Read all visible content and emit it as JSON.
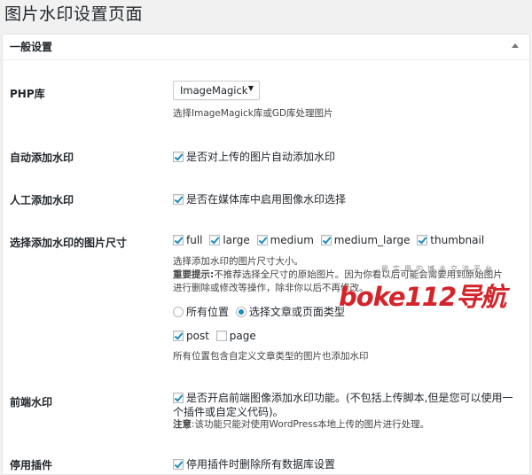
{
  "page": {
    "title": "图片水印设置页面"
  },
  "section": {
    "title": "一般设置"
  },
  "rows": {
    "php_lib": {
      "label": "PHP库",
      "select_value": "ImageMagick",
      "desc": "选择ImageMagick库或GD库处理图片"
    },
    "auto_watermark": {
      "label": "自动添加水印",
      "checkbox_label": "是否对上传的图片自动添加水印"
    },
    "manual_watermark": {
      "label": "人工添加水印",
      "checkbox_label": "是否在媒体库中启用图像水印选择"
    },
    "image_sizes": {
      "label": "选择添加水印的图片尺寸",
      "sizes": [
        "full",
        "large",
        "medium",
        "medium_large",
        "thumbnail"
      ],
      "desc1": "选择添加水印的图片尺寸大小。",
      "desc2_bold": "重要提示:",
      "desc2": "不推荐选择全尺寸的原始图片。因为你看以后可能会需要用到原始图片",
      "desc3": "进行删除或修改等操作，除非你以后不再修改。",
      "radio_all": "所有位置",
      "radio_selected": "选择文章或页面类型",
      "post_type_post": "post",
      "post_type_page": "page",
      "desc4": "所有位置包含自定义文章类型的图片也添加水印"
    },
    "frontend": {
      "label": "前端水印",
      "checkbox_label_line1": "是否开启前端图像添加水印功能。(不包括上传脚本,但是您可以使用一",
      "checkbox_label_line2": "个插件或自定义代码)。",
      "note_bold": "注意",
      "note": ":该功能只能对使用WordPress本地上传的图片进行处理。"
    },
    "deactivate": {
      "label": "停用插件",
      "checkbox_label": "停用插件时删除所有数据库设置"
    }
  },
  "watermark": {
    "text": "boke112导航",
    "sub": "最实用的博主交流平台"
  },
  "colors": {
    "accent": "#1e8cbe",
    "watermark": "#d4242b"
  }
}
